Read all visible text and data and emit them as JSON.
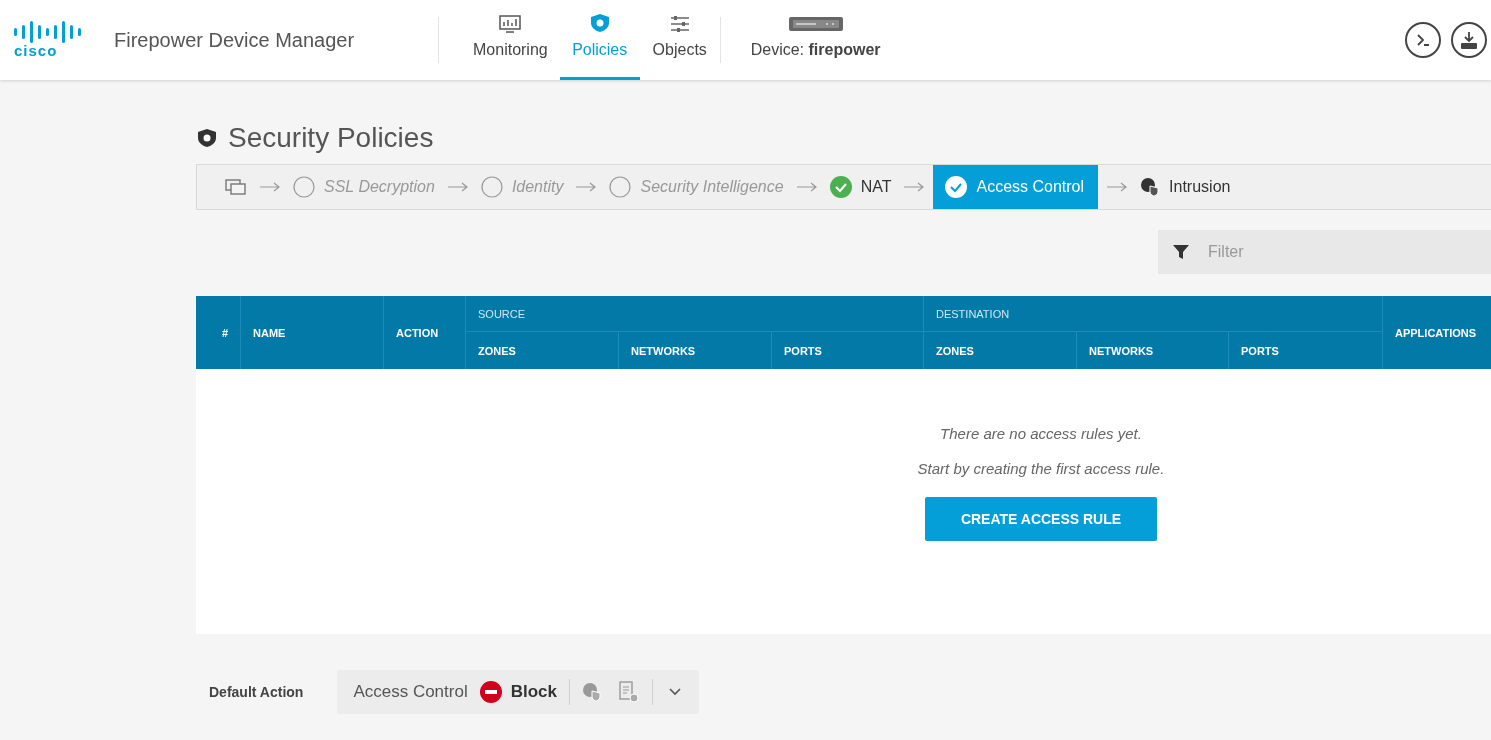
{
  "header": {
    "logo": "cisco",
    "app_title": "Firepower Device Manager",
    "tabs": [
      {
        "label": "Monitoring",
        "selected": false
      },
      {
        "label": "Policies",
        "selected": true
      },
      {
        "label": "Objects",
        "selected": false
      }
    ],
    "device": {
      "label": "Device: ",
      "name": "firepower"
    }
  },
  "page": {
    "title": "Security Policies",
    "steps": [
      {
        "kind": "start"
      },
      {
        "kind": "step",
        "label": "SSL Decryption",
        "checked": false,
        "selected": false
      },
      {
        "kind": "step",
        "label": "Identity",
        "checked": false,
        "selected": false
      },
      {
        "kind": "step",
        "label": "Security Intelligence",
        "checked": false,
        "selected": false
      },
      {
        "kind": "step",
        "label": "NAT",
        "checked": true,
        "selected": false
      },
      {
        "kind": "step",
        "label": "Access Control",
        "checked": true,
        "selected": true
      },
      {
        "kind": "intrusion",
        "label": "Intrusion",
        "selected": false
      }
    ],
    "filter": {
      "placeholder": "Filter"
    },
    "table": {
      "groups": [
        "SOURCE",
        "DESTINATION"
      ],
      "columns": [
        "#",
        "NAME",
        "ACTION",
        "ZONES",
        "NETWORKS",
        "PORTS",
        "ZONES",
        "NETWORKS",
        "PORTS",
        "APPLICATIONS"
      ],
      "empty": {
        "line_1": "There are no access rules yet.",
        "line_2": "Start by creating the first access rule.",
        "button": "CREATE ACCESS RULE"
      }
    },
    "default_action": {
      "label": "Default Action",
      "policy": "Access Control",
      "action": "Block"
    }
  }
}
